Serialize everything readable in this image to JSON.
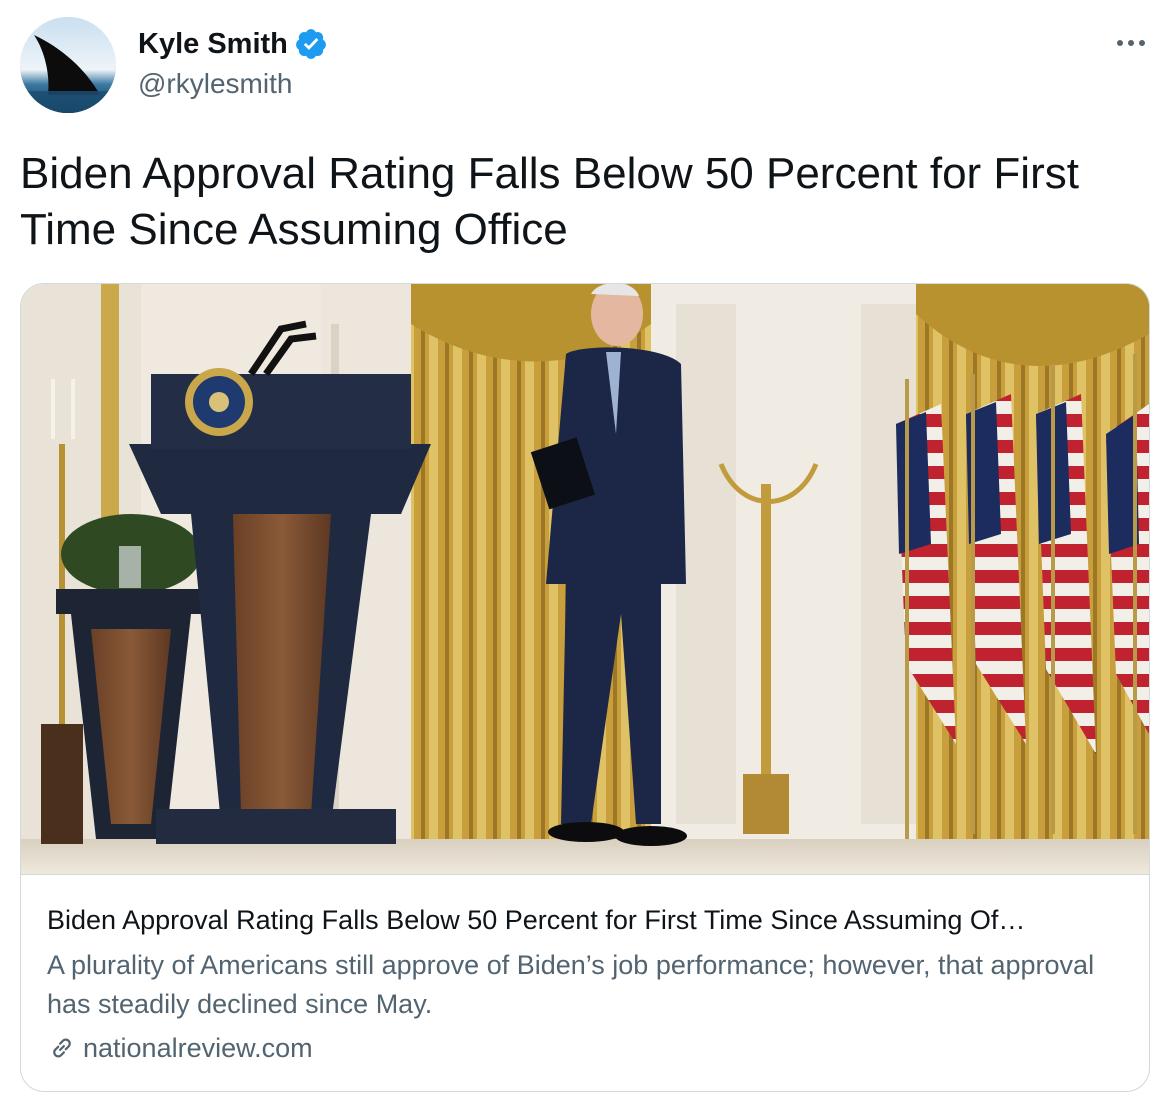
{
  "author": {
    "name": "Kyle Smith",
    "handle": "@rkylesmith",
    "verified": true,
    "avatar_icon": "shark-fin-avatar"
  },
  "tweet": {
    "text": "Biden Approval Rating Falls Below 50 Percent for First Time Since Assuming Office"
  },
  "card": {
    "image_icon": "press-conference-photo",
    "title": "Biden Approval Rating Falls Below 50 Percent for First Time Since Assuming Of…",
    "description": "A plurality of Americans still approve of Biden’s job performance; however, that approval has steadily declined since May.",
    "domain": "nationalreview.com"
  },
  "colors": {
    "verified_blue": "#1d9bf0",
    "secondary_text": "#536471",
    "border": "#cfd9de"
  }
}
